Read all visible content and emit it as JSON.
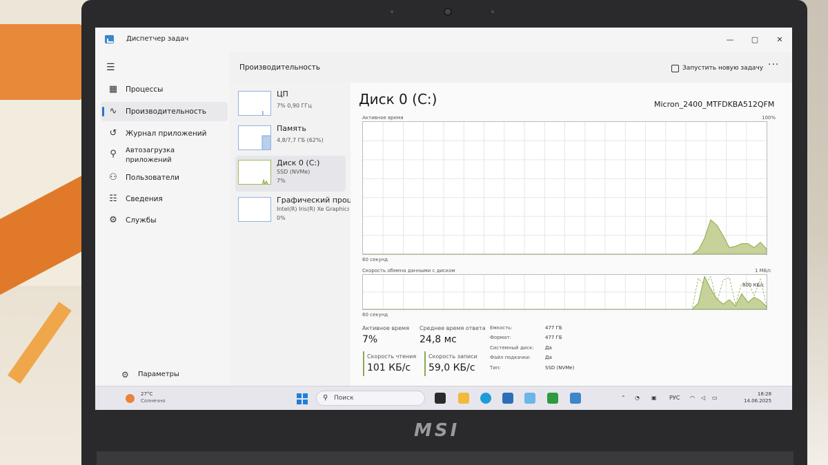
{
  "window": {
    "title": "Диспетчер задач",
    "controls": {
      "minimize": "—",
      "maximize": "▢",
      "close": "✕"
    }
  },
  "sidebar": {
    "menu_icon": "hamburger-icon",
    "items": [
      {
        "label": "Процессы",
        "icon": "processes-icon"
      },
      {
        "label": "Производительность",
        "icon": "performance-icon",
        "active": true
      },
      {
        "label": "Журнал приложений",
        "icon": "history-icon"
      },
      {
        "label": "Автозагрузка приложений",
        "icon": "startup-icon"
      },
      {
        "label": "Пользователи",
        "icon": "users-icon"
      },
      {
        "label": "Сведения",
        "icon": "details-icon"
      },
      {
        "label": "Службы",
        "icon": "services-icon"
      }
    ],
    "settings_label": "Параметры"
  },
  "header": {
    "title": "Производительность",
    "run_task": "Запустить новую задачу",
    "more": "···"
  },
  "devices": [
    {
      "name": "ЦП",
      "line1": "7%  0,90 ГГц",
      "line2": ""
    },
    {
      "name": "Память",
      "line1": "4,8/7,7 ГБ (62%)",
      "line2": ""
    },
    {
      "name": "Диск 0 (C:)",
      "line1": "SSD (NVMe)",
      "line2": "7%",
      "active": true
    },
    {
      "name": "Графический процессор",
      "line1": "Intel(R) Iris(R) Xe Graphics",
      "line2": "0%"
    }
  ],
  "detail": {
    "title": "Диск 0 (C:)",
    "model": "Micron_2400_MTFDKBA512QFM",
    "graph1": {
      "label": "Активное время",
      "max": "100%",
      "time": "60 секунд",
      "values": [
        0,
        0,
        0,
        0,
        0,
        0,
        0,
        0,
        0,
        0,
        0,
        0,
        0,
        0,
        0,
        0,
        0,
        0,
        0,
        0,
        0,
        0,
        0,
        0,
        0,
        0,
        0,
        0,
        0,
        0,
        0,
        0,
        0,
        0,
        0,
        0,
        0,
        0,
        0,
        0,
        0,
        0,
        0,
        0,
        0,
        0,
        0,
        0,
        0,
        0,
        0,
        0,
        0,
        0,
        3,
        12,
        26,
        22,
        14,
        5,
        6,
        8,
        8,
        5,
        9,
        4
      ]
    },
    "graph2": {
      "label": "Скорость обмена данными с диском",
      "max": "1 МБ/с",
      "mid": "800 КБ/с",
      "time": "60 секунд",
      "read": [
        0,
        0,
        0,
        0,
        0,
        0,
        0,
        0,
        0,
        0,
        0,
        0,
        0,
        0,
        0,
        0,
        0,
        0,
        0,
        0,
        0,
        0,
        0,
        0,
        0,
        0,
        0,
        0,
        0,
        0,
        0,
        0,
        0,
        0,
        0,
        0,
        0,
        0,
        0,
        0,
        0,
        0,
        0,
        0,
        0,
        0,
        0,
        0,
        0,
        0,
        0,
        0,
        0,
        0,
        18,
        95,
        60,
        30,
        15,
        28,
        10,
        45,
        20,
        35,
        25,
        8
      ],
      "write": [
        0,
        0,
        0,
        0,
        0,
        0,
        0,
        0,
        0,
        0,
        0,
        0,
        0,
        0,
        0,
        0,
        0,
        0,
        0,
        0,
        0,
        0,
        0,
        0,
        0,
        0,
        0,
        0,
        0,
        0,
        0,
        0,
        0,
        0,
        0,
        0,
        0,
        0,
        0,
        0,
        0,
        0,
        0,
        0,
        0,
        0,
        0,
        0,
        0,
        0,
        0,
        0,
        0,
        0,
        90,
        70,
        95,
        20,
        85,
        92,
        15,
        75,
        80,
        40,
        88,
        10
      ]
    },
    "stats": {
      "active_time_label": "Активное время",
      "active_time": "7%",
      "avg_response_label": "Среднее время ответа",
      "avg_response": "24,8 мс",
      "read_speed_label": "Скорость чтения",
      "read_speed": "101 КБ/с",
      "write_speed_label": "Скорость записи",
      "write_speed": "59,0 КБ/с"
    },
    "properties": [
      {
        "label": "Емкость:",
        "value": "477 ГБ"
      },
      {
        "label": "Формат:",
        "value": "477 ГБ"
      },
      {
        "label": "Системный диск:",
        "value": "Да"
      },
      {
        "label": "Файл подкачки:",
        "value": "Да"
      },
      {
        "label": "Тип:",
        "value": "SSD (NVMe)"
      }
    ]
  },
  "taskbar": {
    "weather_temp": "27°C",
    "weather_desc": "Солнечно",
    "search_placeholder": "Поиск",
    "lang": "РУС",
    "time": "18:28",
    "date": "14.06.2025"
  },
  "colors": {
    "graph_fill": "#c6d29a",
    "graph_line": "#8aa84a",
    "accent": "#2a72c8"
  },
  "brand": "MSI"
}
